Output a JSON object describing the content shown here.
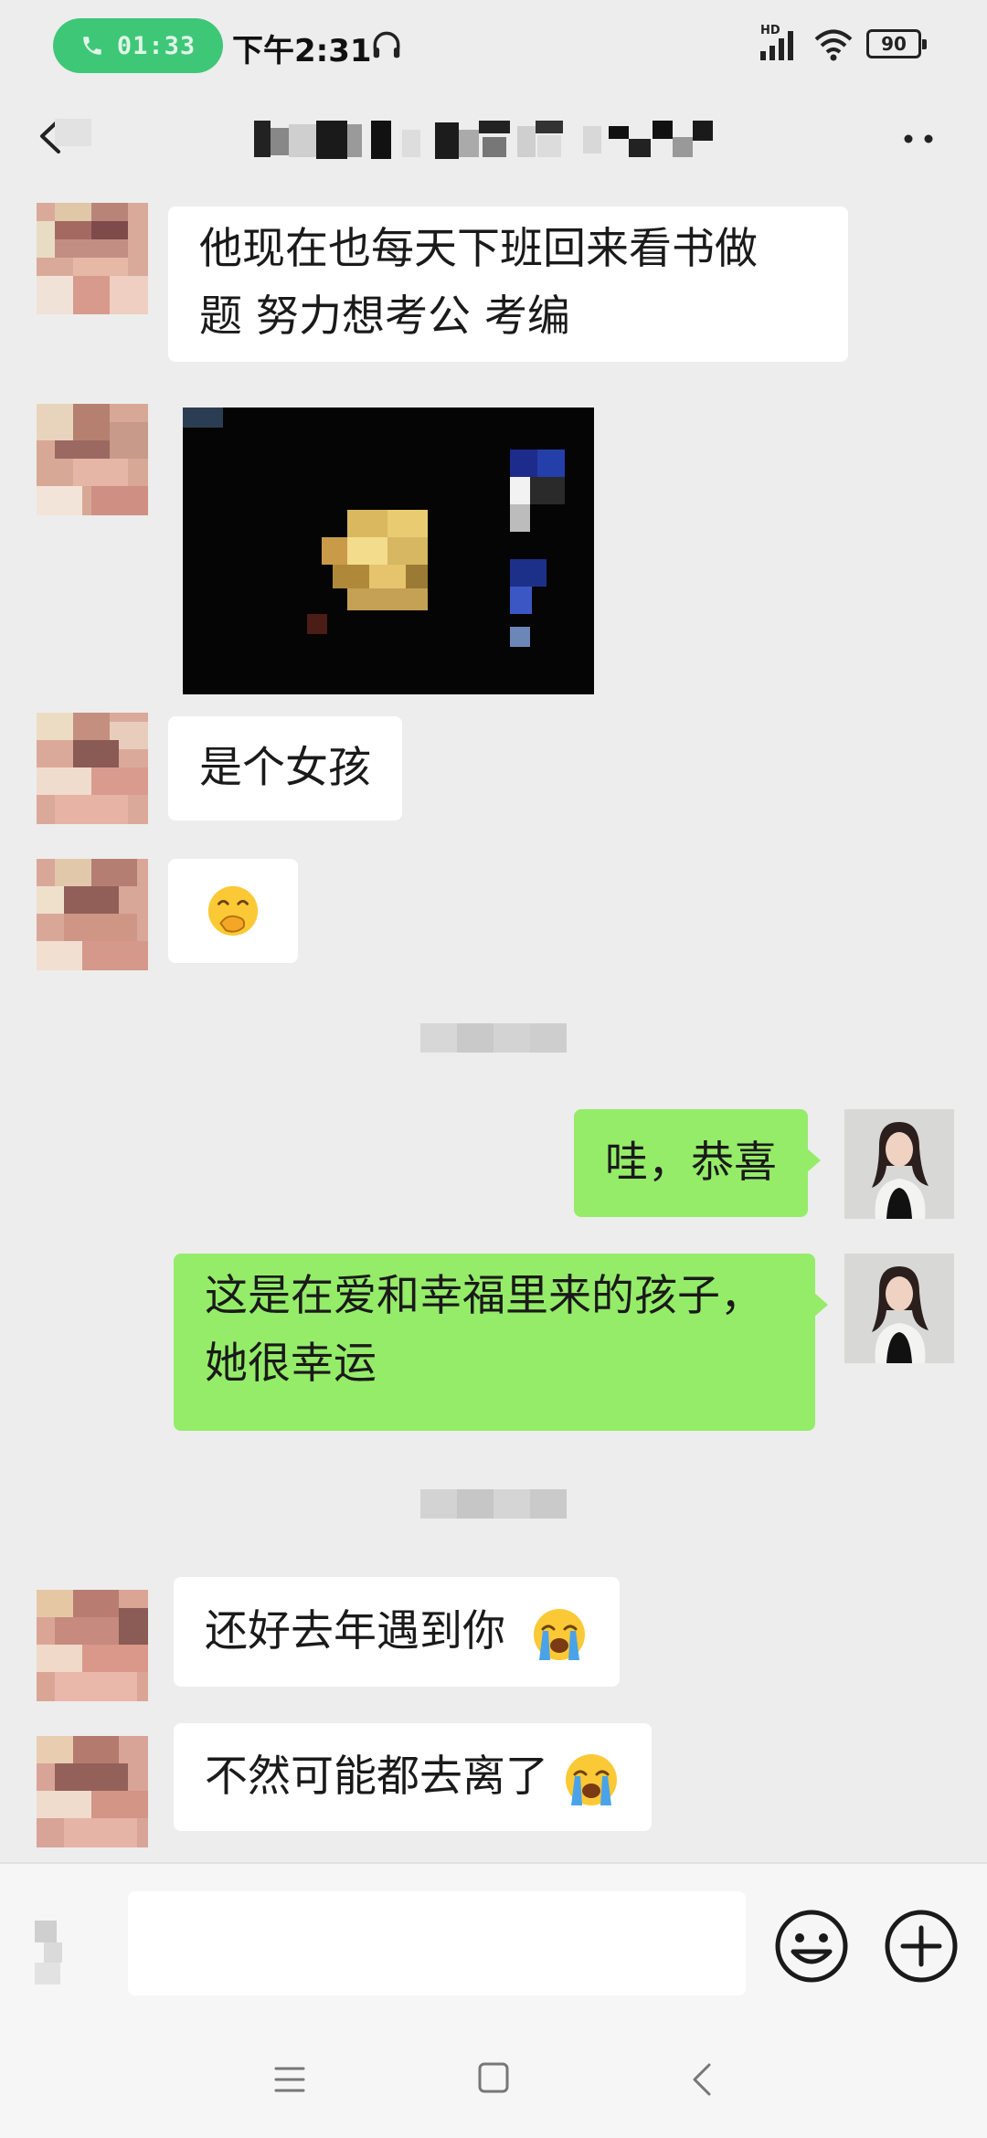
{
  "status_bar": {
    "call_duration": "01:33",
    "time": "下午2:31",
    "network_label": "HD",
    "battery": "90"
  },
  "icons": {
    "call": "phone-icon",
    "headphone": "headphone-icon",
    "signal": "signal-icon",
    "wifi": "wifi-icon",
    "back": "back-arrow-icon",
    "more": "more-dots-icon",
    "emoji": "emoji-icon",
    "plus": "plus-icon"
  },
  "messages": [
    {
      "side": "in",
      "type": "text",
      "lines": [
        "他现在也每天下班回来看书做",
        "题 努力想考公 考编"
      ]
    },
    {
      "side": "in",
      "type": "image"
    },
    {
      "side": "in",
      "type": "text",
      "text": "是个女孩"
    },
    {
      "side": "in",
      "type": "emoji",
      "emoji": "🤭"
    },
    {
      "side": "out",
      "type": "text",
      "text": "哇，恭喜"
    },
    {
      "side": "out",
      "type": "text",
      "lines": [
        "这是在爱和幸福里来的孩子，",
        "她很幸运"
      ]
    },
    {
      "side": "in",
      "type": "text",
      "text": "还好去年遇到你",
      "emoji": "😭"
    },
    {
      "side": "in",
      "type": "text",
      "text": "不然可能都去离了",
      "emoji": "😭"
    }
  ],
  "colors": {
    "background": "#ededed",
    "incoming_bubble": "#ffffff",
    "outgoing_bubble": "#95ec69",
    "call_pill": "#3ec777"
  }
}
